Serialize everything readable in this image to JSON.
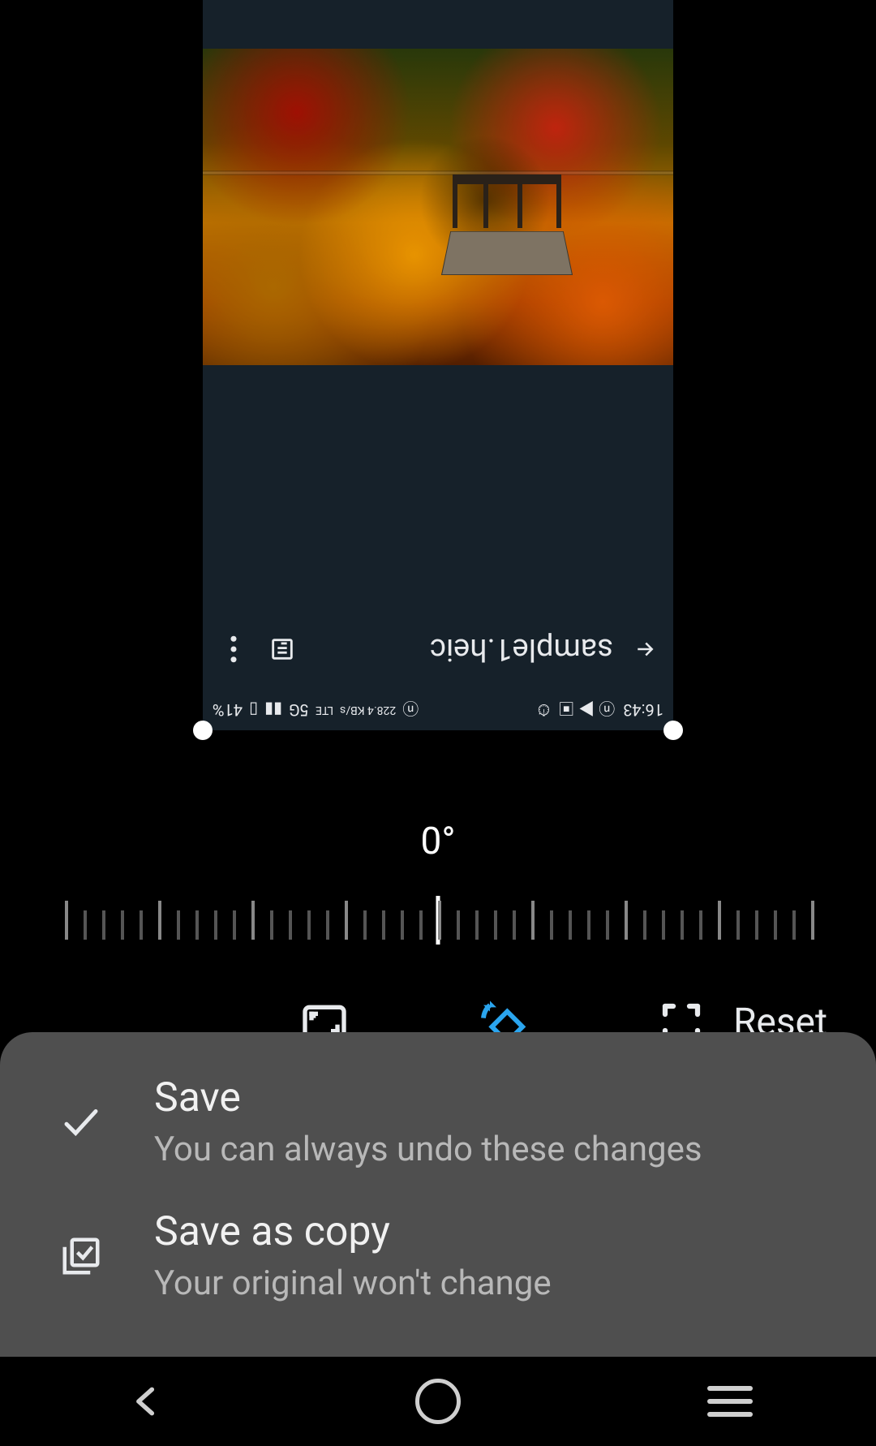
{
  "image_viewer": {
    "filename": "sample1.heic",
    "status_time": "16:43",
    "status_battery": "41%",
    "status_network": "5G",
    "status_speed": "228.4 KB/s",
    "status_lte": "LTE"
  },
  "rotation": {
    "angle_label": "0°"
  },
  "tools": {
    "reset_label": "Reset"
  },
  "save_sheet": {
    "save_title": "Save",
    "save_subtitle": "You can always undo these changes",
    "saveas_title": "Save as copy",
    "saveas_subtitle": "Your original won't change"
  }
}
